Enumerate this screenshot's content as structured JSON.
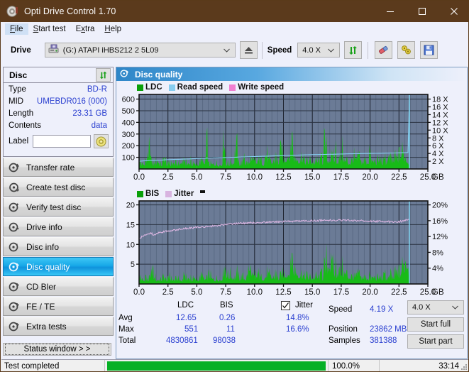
{
  "window": {
    "title": "Opti Drive Control 1.70",
    "icon": "disc-icon",
    "minimize": "minimize-icon",
    "maximize": "maximize-icon",
    "close": "close-icon",
    "titlebar_color": "#5b3a1c"
  },
  "menu": {
    "items": [
      {
        "label": "File",
        "accel": "F",
        "active": true
      },
      {
        "label": "Start test",
        "accel": "S",
        "active": false
      },
      {
        "label": "Extra",
        "accel": "x",
        "active": false
      },
      {
        "label": "Help",
        "accel": "H",
        "active": false
      }
    ]
  },
  "toolbar": {
    "drive_label": "Drive",
    "drive_value": "(G:)  ATAPI iHBS212  2 5L09",
    "eject_icon": "eject-icon",
    "speed_label": "Speed",
    "speed_value": "4.0 X",
    "refresh_icon": "refresh-icon",
    "erase_icon": "eraser-icon",
    "tools_icon": "tools-icon",
    "save_icon": "save-icon"
  },
  "disc_panel": {
    "title": "Disc",
    "refresh_icon": "refresh-icon",
    "rows": [
      {
        "key": "Type",
        "value": "BD-R"
      },
      {
        "key": "MID",
        "value": "UMEBDR016 (000)"
      },
      {
        "key": "Length",
        "value": "23.31 GB"
      },
      {
        "key": "Contents",
        "value": "data"
      }
    ],
    "label_key": "Label",
    "label_value": "",
    "label_placeholder": "",
    "label_button_icon": "disc-icon"
  },
  "nav": {
    "items": [
      {
        "label": "Transfer rate",
        "icon": "disc-speed-icon",
        "selected": false
      },
      {
        "label": "Create test disc",
        "icon": "disc-write-icon",
        "selected": false
      },
      {
        "label": "Verify test disc",
        "icon": "disc-check-icon",
        "selected": false
      },
      {
        "label": "Drive info",
        "icon": "drive-info-icon",
        "selected": false
      },
      {
        "label": "Disc info",
        "icon": "disc-info-icon",
        "selected": false
      },
      {
        "label": "Disc quality",
        "icon": "disc-quality-icon",
        "selected": true
      },
      {
        "label": "CD Bler",
        "icon": "disc-bler-icon",
        "selected": false
      },
      {
        "label": "FE / TE",
        "icon": "disc-fete-icon",
        "selected": false
      },
      {
        "label": "Extra tests",
        "icon": "disc-extra-icon",
        "selected": false
      }
    ],
    "status_window_button": "Status window > >"
  },
  "content": {
    "header_title": "Disc quality",
    "header_icon": "disc-quality-icon"
  },
  "stats": {
    "col_ldc": "LDC",
    "col_bis": "BIS",
    "jitter_label": "Jitter",
    "jitter_checked": true,
    "row_avg": "Avg",
    "row_max": "Max",
    "row_total": "Total",
    "avg_ldc": "12.65",
    "avg_bis": "0.26",
    "avg_jitter": "14.8%",
    "max_ldc": "551",
    "max_bis": "11",
    "max_jitter": "16.6%",
    "total_ldc": "4830861",
    "total_bis": "98038",
    "speed_label": "Speed",
    "speed_value": "4.19 X",
    "position_label": "Position",
    "position_value": "23862 MB",
    "samples_label": "Samples",
    "samples_value": "381388",
    "speed_select": "4.0 X",
    "start_full": "Start full",
    "start_part": "Start part"
  },
  "statusbar": {
    "message": "Test completed",
    "percent": "100.0%",
    "progress_value": 100,
    "elapsed": "33:14",
    "progress_color": "#06b025"
  },
  "chart_data": [
    {
      "type": "area",
      "id": "ldc-chart",
      "title": "",
      "xlabel": "GB",
      "ylabel": "",
      "xlim": [
        0,
        25
      ],
      "xticks": [
        "0.0",
        "2.5",
        "5.0",
        "7.5",
        "10.0",
        "12.5",
        "15.0",
        "17.5",
        "20.0",
        "22.5",
        "25.0"
      ],
      "xtickvals": [
        0,
        2.5,
        5,
        7.5,
        10,
        12.5,
        15,
        17.5,
        20,
        22.5,
        25
      ],
      "ylim": [
        0,
        640
      ],
      "yticks": [
        "100",
        "200",
        "300",
        "400",
        "500",
        "600"
      ],
      "ytickvals": [
        100,
        200,
        300,
        400,
        500,
        600
      ],
      "y2lim": [
        0,
        19.2
      ],
      "y2ticks": [
        "2 X",
        "4 X",
        "6 X",
        "8 X",
        "10 X",
        "12 X",
        "14 X",
        "16 X",
        "18 X"
      ],
      "y2tickvals": [
        2,
        4,
        6,
        8,
        10,
        12,
        14,
        16,
        18
      ],
      "grid": true,
      "legend": [
        {
          "name": "LDC",
          "color": "#18bb18"
        },
        {
          "name": "Read speed",
          "color": "#87cdf0"
        },
        {
          "name": "Write speed",
          "color": "#f07fd0"
        }
      ],
      "plot_bg": "#6b7b96",
      "data_end_x": 23.4,
      "series": [
        {
          "name": "LDC",
          "color": "#18bb18",
          "kind": "area",
          "x": [
            0.0,
            0.2,
            0.4,
            0.6,
            0.8,
            1.0,
            1.1,
            1.2,
            1.4,
            1.6,
            1.8,
            2.0,
            2.2,
            2.4,
            2.5,
            2.7,
            2.9,
            3.1,
            3.3,
            3.5,
            3.7,
            3.9,
            4.1,
            4.3,
            4.5,
            4.7,
            4.9,
            5.1,
            5.3,
            5.5,
            5.7,
            5.9,
            6.0,
            6.2,
            6.4,
            6.6,
            6.8,
            7.0,
            7.2,
            7.35,
            7.45,
            7.5,
            7.6,
            7.8,
            8.0,
            8.2,
            8.4,
            8.6,
            8.8,
            9.0,
            9.1,
            9.2,
            9.4,
            9.6,
            9.8,
            10.0,
            10.2,
            10.4,
            10.6,
            10.8,
            11.0,
            11.2,
            11.4,
            11.5,
            11.7,
            11.9,
            12.1,
            12.3,
            12.5,
            12.7,
            12.9,
            13.1,
            13.3,
            13.5,
            13.7,
            13.9,
            14.1,
            14.3,
            14.5,
            14.7,
            14.9,
            15.1,
            15.3,
            15.5,
            15.7,
            15.9,
            16.1,
            16.3,
            16.5,
            16.6,
            16.8,
            17.0,
            17.2,
            17.4,
            17.6,
            17.8,
            18.0,
            18.2,
            18.4,
            18.6,
            18.8,
            19.0,
            19.2,
            19.4,
            19.6,
            19.8,
            20.0,
            20.2,
            20.4,
            20.6,
            20.8,
            21.0,
            21.2,
            21.4,
            21.6,
            21.8,
            22.0,
            22.2,
            22.4,
            22.6,
            22.8,
            23.0,
            23.2,
            23.35
          ],
          "y": [
            55,
            62,
            70,
            58,
            240,
            130,
            95,
            68,
            75,
            150,
            60,
            68,
            170,
            70,
            62,
            60,
            90,
            75,
            68,
            60,
            120,
            66,
            72,
            60,
            85,
            65,
            60,
            70,
            95,
            60,
            75,
            355,
            70,
            65,
            62,
            90,
            70,
            65,
            80,
            550,
            290,
            110,
            80,
            75,
            105,
            95,
            355,
            80,
            90,
            75,
            295,
            100,
            85,
            80,
            110,
            95,
            75,
            90,
            120,
            85,
            270,
            105,
            95,
            85,
            120,
            100,
            110,
            285,
            140,
            180,
            220,
            190,
            240,
            150,
            170,
            135,
            200,
            120,
            100,
            110,
            130,
            95,
            105,
            120,
            90,
            110,
            345,
            130,
            150,
            175,
            120,
            195,
            110,
            140,
            260,
            100,
            130,
            90,
            115,
            170,
            100,
            125,
            95,
            110,
            130,
            105,
            180,
            95,
            120,
            100,
            140,
            115,
            90,
            110,
            150,
            100,
            130,
            120,
            165,
            205,
            255,
            190,
            140,
            95
          ]
        },
        {
          "name": "Read speed",
          "color": "#87cdf0",
          "kind": "line",
          "axis": "right",
          "x": [
            0.0,
            0.5,
            1.0,
            1.5,
            2.0,
            2.5,
            3.0,
            3.5,
            4.0,
            4.5,
            5.0,
            5.5,
            6.0,
            6.5,
            7.0,
            7.5,
            8.0,
            8.5,
            9.0,
            9.5,
            10.0,
            10.5,
            11.0,
            11.5,
            12.0,
            12.5,
            13.0,
            13.5,
            14.0,
            14.5,
            15.0,
            15.5,
            16.0,
            16.5,
            17.0,
            17.5,
            18.0,
            18.5,
            19.0,
            19.5,
            20.0,
            20.5,
            21.0,
            21.5,
            22.0,
            22.5,
            23.0,
            23.3,
            23.35,
            23.38
          ],
          "y": [
            2.0,
            2.1,
            2.2,
            2.25,
            2.3,
            2.4,
            2.45,
            2.5,
            2.55,
            2.6,
            2.7,
            2.75,
            2.8,
            2.85,
            2.9,
            2.95,
            3.0,
            3.05,
            3.1,
            3.15,
            3.2,
            3.25,
            3.3,
            3.35,
            3.4,
            3.45,
            3.5,
            3.55,
            3.6,
            3.65,
            3.7,
            3.72,
            3.75,
            3.78,
            3.8,
            3.85,
            3.9,
            3.92,
            3.95,
            3.98,
            4.0,
            4.02,
            4.05,
            4.08,
            4.1,
            4.15,
            4.2,
            4.25,
            12.0,
            18.0
          ]
        }
      ]
    },
    {
      "type": "area",
      "id": "bis-chart",
      "title": "",
      "xlabel": "GB",
      "ylabel": "",
      "xlim": [
        0,
        25
      ],
      "xticks": [
        "0.0",
        "2.5",
        "5.0",
        "7.5",
        "10.0",
        "12.5",
        "15.0",
        "17.5",
        "20.0",
        "22.5",
        "25.0"
      ],
      "xtickvals": [
        0,
        2.5,
        5,
        7.5,
        10,
        12.5,
        15,
        17.5,
        20,
        22.5,
        25
      ],
      "ylim": [
        0,
        21
      ],
      "yticks": [
        "5",
        "10",
        "15",
        "20"
      ],
      "ytickvals": [
        5,
        10,
        15,
        20
      ],
      "y2lim": [
        0,
        21
      ],
      "y2ticks": [
        "4%",
        "8%",
        "12%",
        "16%",
        "20%"
      ],
      "y2tickvals": [
        4,
        8,
        12,
        16,
        20
      ],
      "grid": true,
      "legend": [
        {
          "name": "BIS",
          "color": "#18bb18"
        },
        {
          "name": "Jitter",
          "color": "#d8b4e0"
        }
      ],
      "plot_bg": "#6b7b96",
      "data_end_x": 23.4,
      "series": [
        {
          "name": "BIS",
          "color": "#18bb18",
          "kind": "area",
          "x": [
            0.0,
            0.2,
            0.4,
            0.6,
            0.8,
            1.0,
            1.15,
            1.3,
            1.5,
            1.7,
            1.9,
            2.1,
            2.3,
            2.5,
            2.7,
            2.9,
            3.1,
            3.3,
            3.5,
            3.7,
            3.9,
            4.1,
            4.3,
            4.5,
            4.7,
            4.9,
            5.1,
            5.3,
            5.5,
            5.7,
            5.9,
            6.1,
            6.3,
            6.5,
            6.7,
            6.9,
            7.1,
            7.3,
            7.45,
            7.5,
            7.7,
            7.9,
            8.1,
            8.3,
            8.5,
            8.7,
            8.9,
            9.1,
            9.3,
            9.5,
            9.7,
            9.9,
            10.1,
            10.3,
            10.5,
            10.7,
            10.9,
            11.1,
            11.3,
            11.5,
            11.7,
            11.9,
            12.1,
            12.3,
            12.5,
            12.7,
            12.9,
            13.1,
            13.3,
            13.5,
            13.7,
            13.9,
            14.1,
            14.3,
            14.5,
            14.7,
            14.9,
            15.1,
            15.3,
            15.5,
            15.7,
            15.9,
            16.1,
            16.3,
            16.45,
            16.6,
            16.8,
            17.0,
            17.2,
            17.4,
            17.6,
            17.8,
            18.0,
            18.2,
            18.4,
            18.6,
            18.8,
            19.0,
            19.2,
            19.4,
            19.6,
            19.8,
            20.0,
            20.2,
            20.4,
            20.6,
            20.8,
            21.0,
            21.2,
            21.4,
            21.6,
            21.8,
            22.0,
            22.2,
            22.4,
            22.6,
            22.75,
            22.9,
            23.0,
            23.1,
            23.2,
            23.3,
            23.35
          ],
          "y": [
            1.6,
            1.8,
            1.5,
            1.7,
            1.6,
            2.0,
            7.0,
            2.2,
            1.8,
            2.0,
            1.7,
            3.0,
            2.0,
            1.8,
            2.5,
            1.9,
            1.7,
            2.2,
            1.8,
            1.6,
            2.4,
            1.9,
            2.0,
            1.7,
            2.2,
            1.8,
            1.9,
            2.5,
            2.0,
            1.8,
            2.2,
            4.3,
            2.0,
            1.9,
            2.4,
            2.1,
            1.9,
            4.2,
            9.2,
            5.5,
            3.5,
            4.0,
            3.0,
            2.8,
            3.5,
            2.6,
            3.0,
            2.7,
            2.5,
            6.5,
            3.0,
            2.8,
            2.6,
            3.3,
            2.4,
            3.0,
            2.7,
            4.5,
            2.8,
            2.6,
            3.0,
            2.5,
            2.8,
            3.2,
            4.5,
            5.0,
            4.5,
            6.2,
            5.5,
            6.5,
            5.0,
            4.2,
            4.5,
            3.0,
            3.5,
            2.8,
            3.0,
            2.6,
            3.2,
            2.8,
            3.0,
            2.6,
            6.5,
            7.8,
            10.1,
            8.0,
            6.0,
            4.5,
            5.5,
            5.0,
            6.5,
            4.0,
            4.5,
            3.0,
            3.2,
            2.6,
            3.0,
            2.8,
            2.5,
            3.2,
            2.6,
            3.0,
            2.2,
            2.6,
            3.0,
            2.4,
            2.8,
            2.5,
            3.0,
            2.6,
            2.4,
            3.0,
            2.6,
            3.4,
            5.5,
            4.0,
            7.0,
            8.5,
            9.0,
            11.0,
            9.5,
            10.2,
            5.0
          ]
        },
        {
          "name": "Jitter",
          "color": "#d8b4e0",
          "kind": "line",
          "x": [
            0.0,
            0.3,
            0.6,
            0.9,
            1.1,
            1.2,
            1.4,
            1.7,
            2.0,
            2.3,
            2.6,
            3.0,
            3.4,
            3.8,
            4.2,
            4.6,
            5.0,
            5.4,
            5.8,
            6.2,
            6.6,
            7.0,
            7.4,
            7.8,
            8.2,
            8.6,
            9.0,
            9.4,
            9.8,
            10.2,
            10.6,
            11.0,
            11.4,
            11.8,
            12.2,
            12.6,
            13.0,
            13.4,
            13.8,
            14.2,
            14.6,
            15.0,
            15.4,
            15.8,
            16.2,
            16.6,
            17.0,
            17.4,
            17.8,
            18.2,
            18.6,
            19.0,
            19.4,
            19.8,
            20.2,
            20.6,
            21.0,
            21.4,
            21.8,
            22.2,
            22.6,
            23.0,
            23.3
          ],
          "y": [
            11.6,
            12.0,
            12.3,
            12.6,
            12.9,
            12.2,
            12.6,
            12.9,
            13.1,
            13.3,
            13.4,
            13.6,
            13.8,
            13.9,
            14.1,
            14.2,
            14.3,
            14.4,
            14.5,
            14.6,
            14.7,
            14.8,
            14.9,
            15.1,
            15.2,
            15.3,
            15.35,
            15.4,
            15.5,
            15.5,
            15.6,
            15.6,
            15.7,
            15.7,
            15.75,
            15.8,
            15.8,
            15.85,
            15.9,
            15.9,
            15.95,
            16.0,
            16.0,
            16.05,
            16.1,
            16.1,
            16.1,
            16.15,
            16.1,
            16.1,
            16.05,
            16.0,
            15.95,
            15.9,
            15.85,
            15.8,
            15.8,
            15.75,
            15.7,
            15.7,
            15.8,
            16.0,
            16.3
          ]
        }
      ]
    }
  ]
}
